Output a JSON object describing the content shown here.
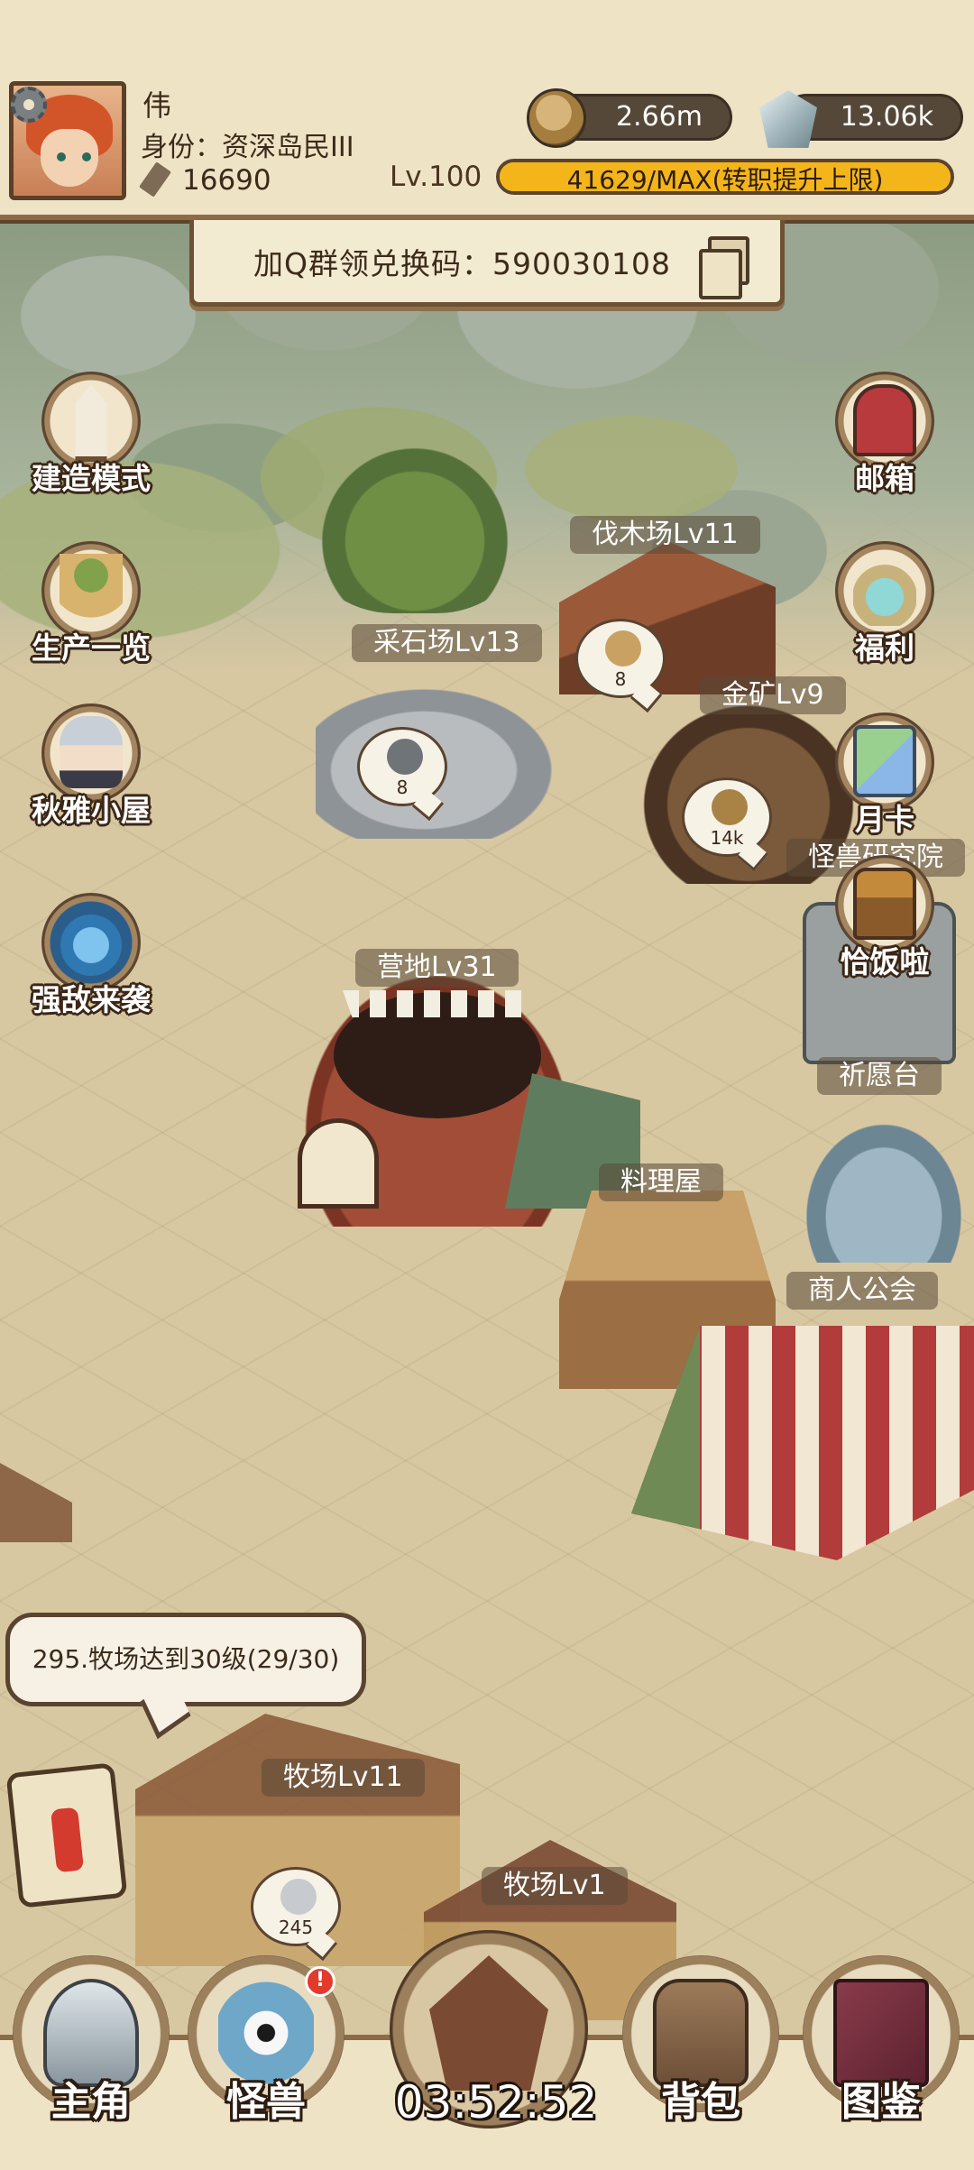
{
  "player": {
    "name": "伟",
    "title": "身份：资深岛民III",
    "power": "16690",
    "level": "Lv.100"
  },
  "resources": {
    "coins": "2.66m",
    "gems": "13.06k"
  },
  "experience": {
    "text": "41629/MAX(转职提升上限)",
    "progress_percent": 100
  },
  "redeem_banner": {
    "text": "加Q群领兑换码：590030108"
  },
  "left_menu": [
    {
      "label": "建造模式",
      "icon": "build-tower-icon"
    },
    {
      "label": "生产一览",
      "icon": "food-basket-icon"
    },
    {
      "label": "秋雅小屋",
      "icon": "girl-portrait-icon"
    },
    {
      "label": "强敌来袭",
      "icon": "demon-head-icon"
    }
  ],
  "right_menu": [
    {
      "label": "邮箱",
      "icon": "mailbox-icon"
    },
    {
      "label": "福利",
      "icon": "gift-jar-icon"
    },
    {
      "label": "月卡",
      "icon": "month-card-icon"
    },
    {
      "label": "恰饭啦",
      "icon": "treasure-chest-icon"
    }
  ],
  "buildings": {
    "lumber": "伐木场Lv11",
    "quarry": "采石场Lv13",
    "goldmine": "金矿Lv9",
    "research": "怪兽研究院",
    "camp": "营地Lv31",
    "wish": "祈愿台",
    "kitchen": "料理屋",
    "guild": "商人公会",
    "ranch1": "牧场Lv11",
    "ranch2": "牧场Lv1"
  },
  "production_bubbles": {
    "lumber": "8",
    "quarry": "8",
    "gold": "14k",
    "ranch": "245"
  },
  "task": {
    "text": "295.牧场达到30级(29/30)"
  },
  "bottom_nav": [
    {
      "label": "主角",
      "icon": "knight-helmet-icon"
    },
    {
      "label": "怪兽",
      "icon": "monster-eye-icon",
      "badge": "!"
    },
    {
      "label": "背包",
      "icon": "backpack-icon"
    },
    {
      "label": "图鉴",
      "icon": "monster-book-icon"
    }
  ],
  "timer": "03:52:52",
  "colors": {
    "accent_gold": "#ffd23e",
    "frame_brown": "#5a4330",
    "badge_red": "#e33a2c"
  }
}
